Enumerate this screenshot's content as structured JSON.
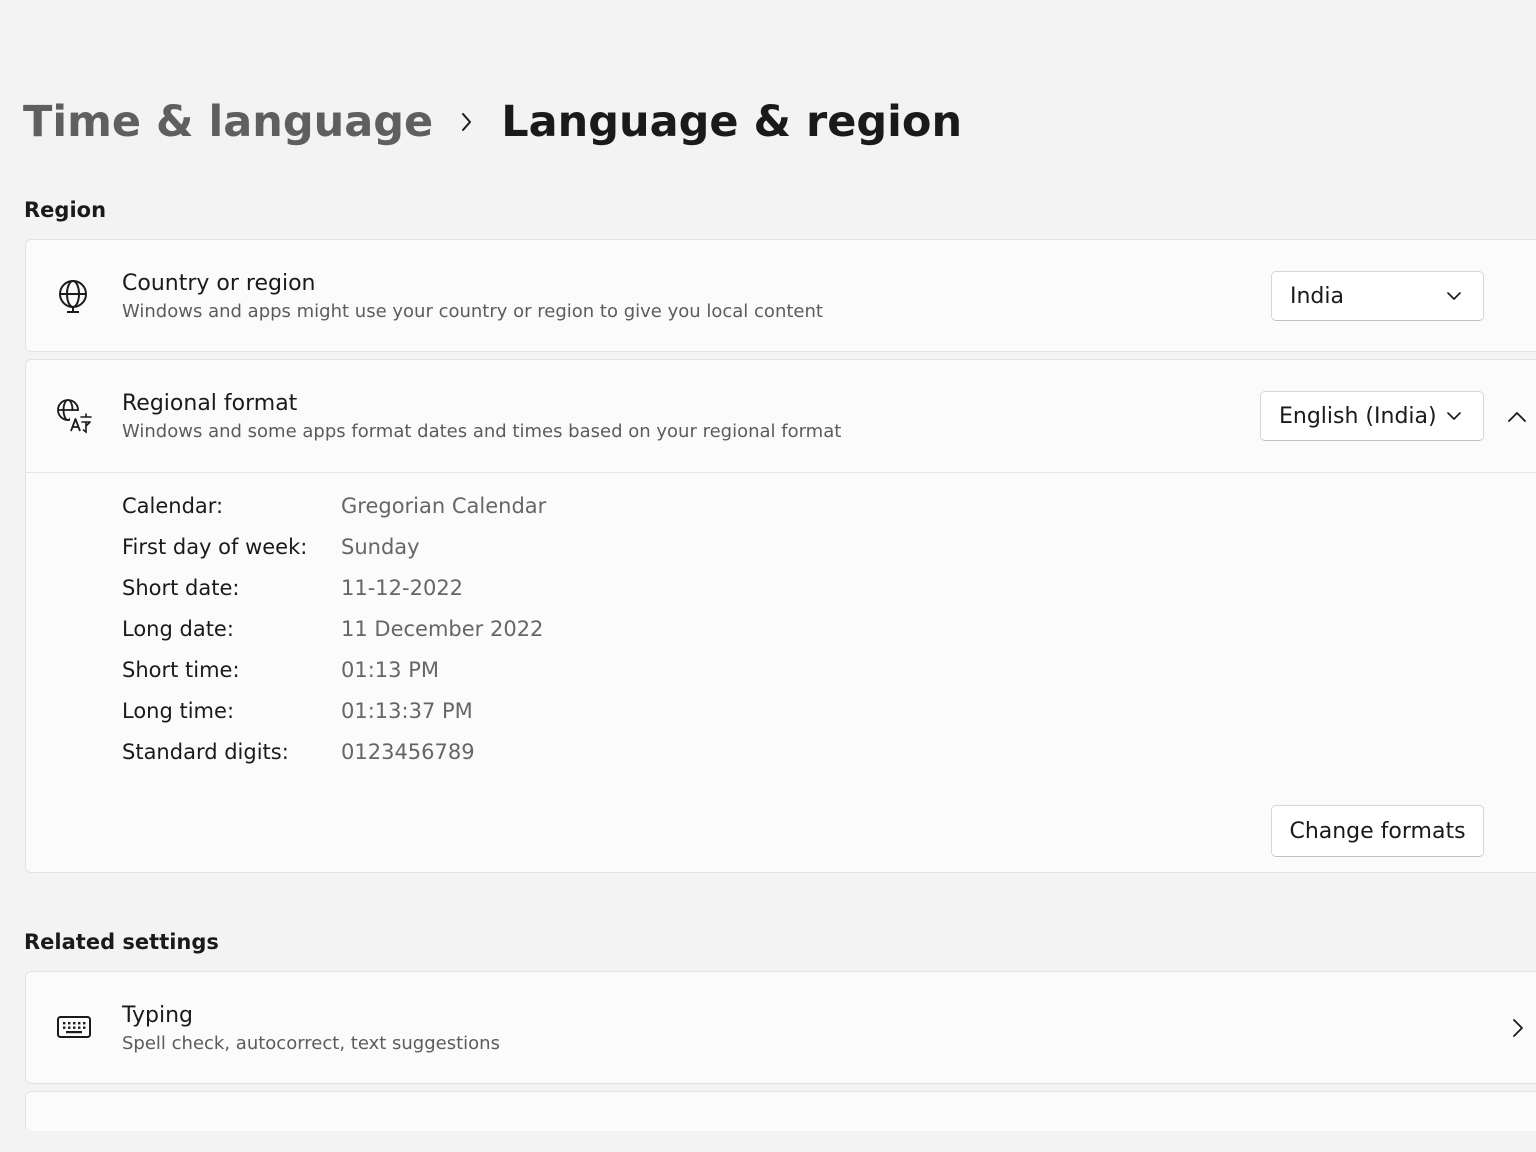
{
  "breadcrumb": {
    "parent": "Time & language",
    "current": "Language & region"
  },
  "region_section": {
    "title": "Region",
    "country": {
      "icon": "globe-icon",
      "title": "Country or region",
      "description": "Windows and apps might use your country or region to give you local content",
      "selected": "India"
    },
    "regional_format": {
      "icon": "language-globe-icon",
      "title": "Regional format",
      "description": "Windows and some apps format dates and times based on your regional format",
      "selected": "English (India)",
      "expanded": true,
      "details": [
        {
          "label": "Calendar:",
          "value": "Gregorian Calendar"
        },
        {
          "label": "First day of week:",
          "value": "Sunday"
        },
        {
          "label": "Short date:",
          "value": "11-12-2022"
        },
        {
          "label": "Long date:",
          "value": "11 December 2022"
        },
        {
          "label": "Short time:",
          "value": "01:13 PM"
        },
        {
          "label": "Long time:",
          "value": "01:13:37 PM"
        },
        {
          "label": "Standard digits:",
          "value": "0123456789"
        }
      ],
      "change_button": "Change formats"
    }
  },
  "related_section": {
    "title": "Related settings",
    "typing": {
      "icon": "keyboard-icon",
      "title": "Typing",
      "description": "Spell check, autocorrect, text suggestions"
    }
  },
  "colors": {
    "background": "#f3f3f3",
    "card": "#fbfbfb",
    "border": "#e3e3e3",
    "text_primary": "#1a1a1a",
    "text_secondary": "#5c5c5c"
  }
}
